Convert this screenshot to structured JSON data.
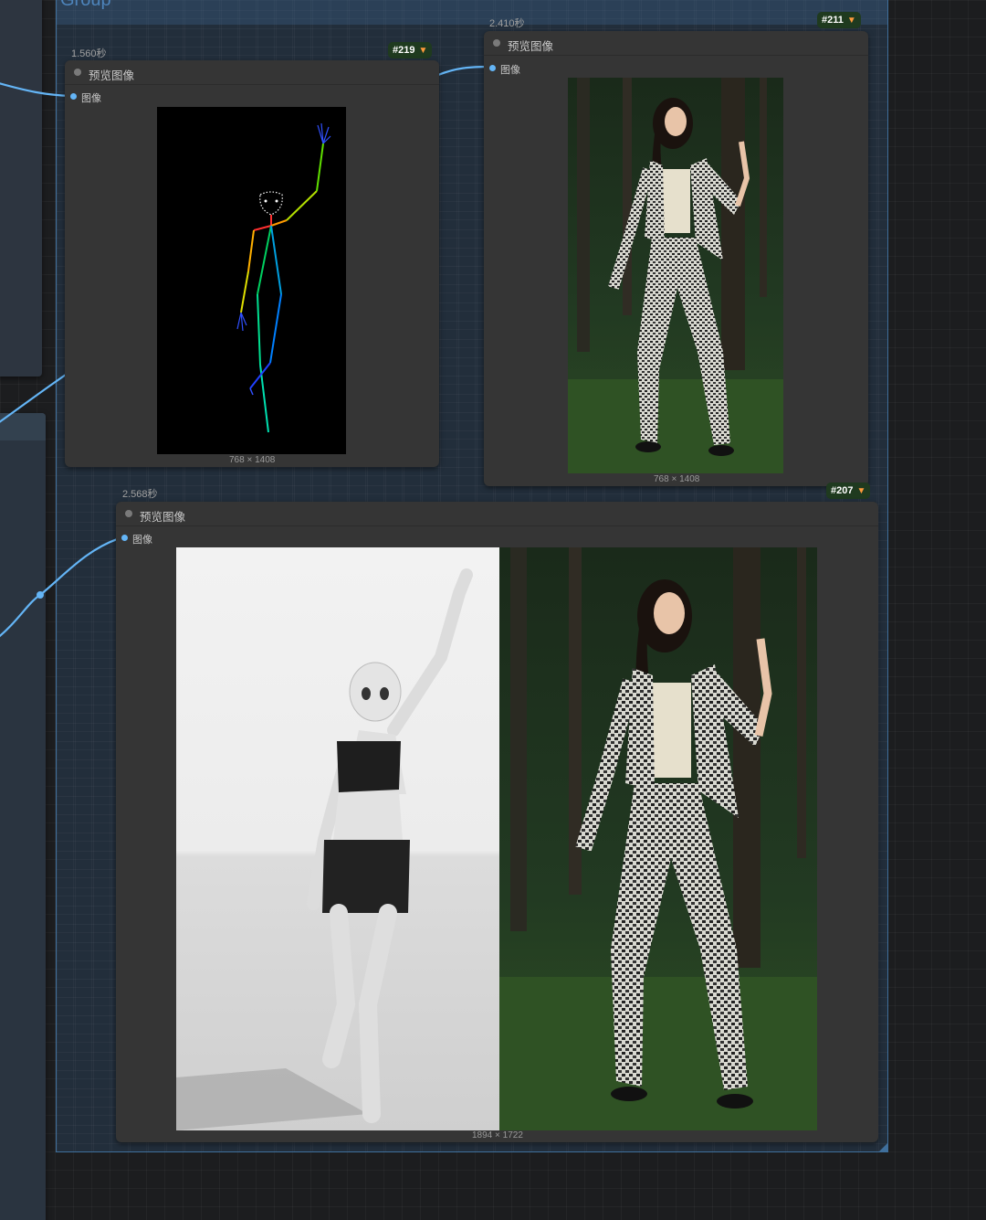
{
  "group": {
    "title": "Group"
  },
  "nodes": [
    {
      "id": "#219",
      "exec_time": "1.560秒",
      "title": "预览图像",
      "input": "图像",
      "dims": "768 × 1408"
    },
    {
      "id": "#211",
      "exec_time": "2.410秒",
      "title": "预览图像",
      "input": "图像",
      "dims": "768 × 1408"
    },
    {
      "id": "#207",
      "exec_time": "2.568秒",
      "title": "预览图像",
      "input": "图像",
      "dims": "1894 × 1722"
    }
  ],
  "icons": {
    "badge": "fox-icon",
    "slot": "input-dot-icon",
    "status": "status-dot-icon"
  },
  "colors": {
    "link": "#64b5f6",
    "group_border": "#3f6f9c",
    "group_title": "#4f88c0",
    "node_bg": "#353535",
    "badge_bg": "#1f3a1f"
  }
}
